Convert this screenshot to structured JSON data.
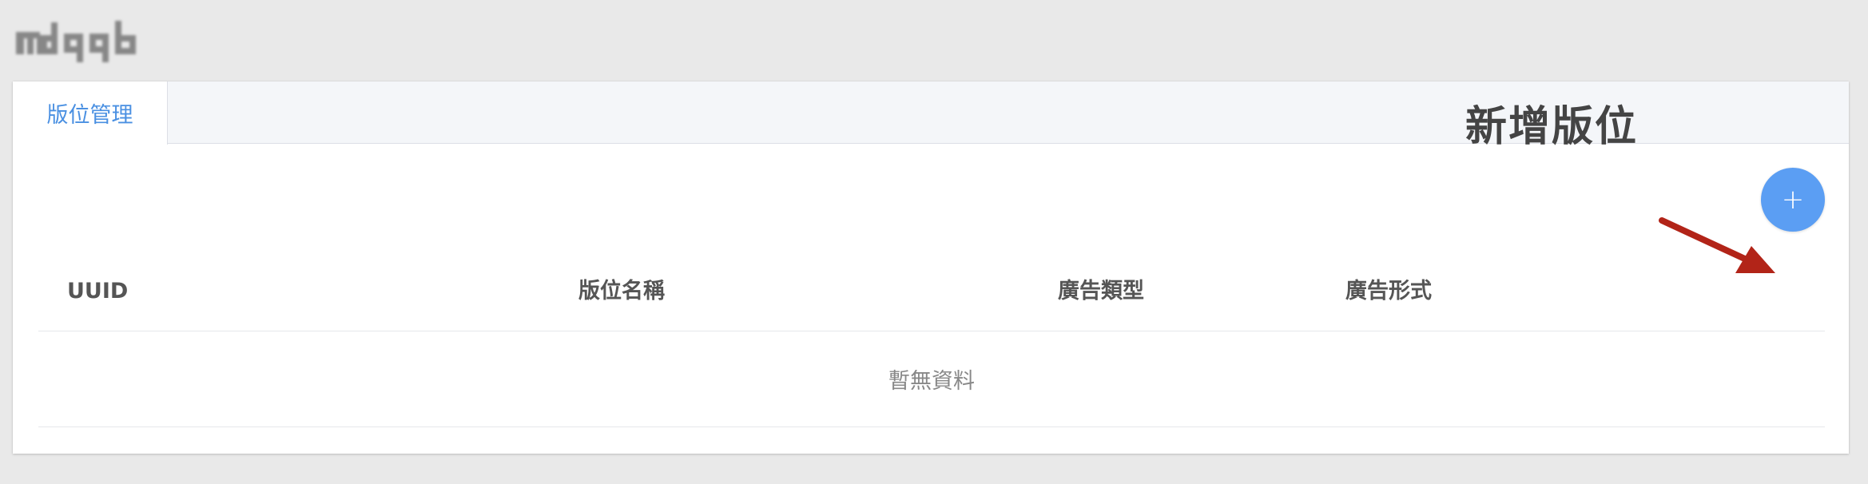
{
  "logo": {
    "alt": "mdqb"
  },
  "tabs": [
    {
      "label": "版位管理",
      "active": true
    }
  ],
  "annotation": {
    "text": "新增版位",
    "arrow_color": "#b22418"
  },
  "add_button": {
    "icon": "plus-icon",
    "label": "+",
    "color": "#5b9ef3"
  },
  "table": {
    "columns": [
      "UUID",
      "版位名稱",
      "廣告類型",
      "廣告形式"
    ],
    "empty_text": "暫無資料"
  },
  "colors": {
    "accent": "#4a90e2",
    "background": "#e9e9e9",
    "tab_bar": "#f4f6f9"
  }
}
